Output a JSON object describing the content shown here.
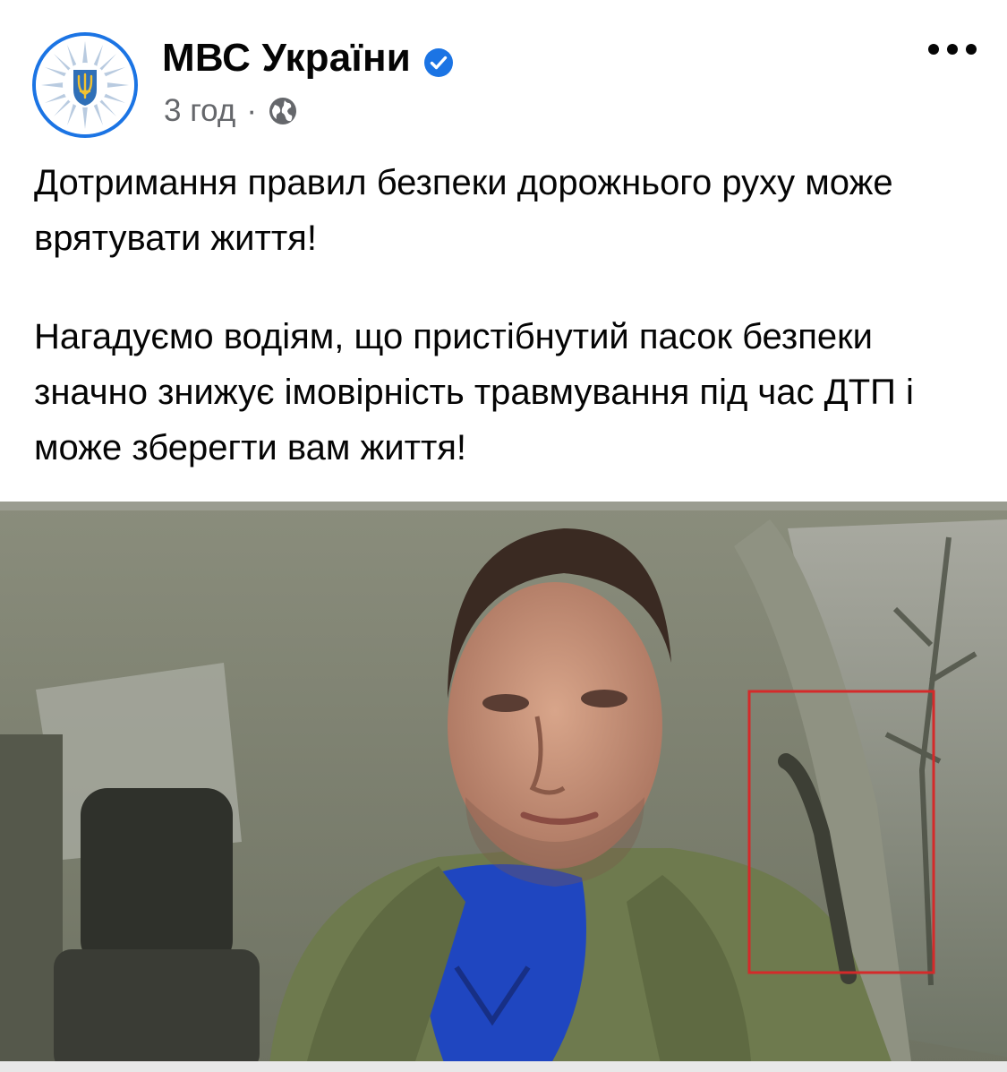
{
  "post": {
    "page_name": "МВС України",
    "verified_icon": "verified-badge-icon",
    "timestamp": "3 год",
    "separator": "·",
    "audience_icon": "globe-icon",
    "more_icon": "more-options-icon",
    "paragraphs": [
      "Дотримання правил безпеки дорожнього руху може врятувати життя!",
      "Нагадуємо водіям, що пристібнутий пасок безпеки значно знижує імовірність травмування під час ДТП і може зберегти вам життя!"
    ],
    "media": {
      "type": "photo",
      "highlight_color": "#d42a2a"
    }
  },
  "colors": {
    "accent": "#1b74e4",
    "secondary_text": "#65676b",
    "primary_text": "#050505"
  }
}
